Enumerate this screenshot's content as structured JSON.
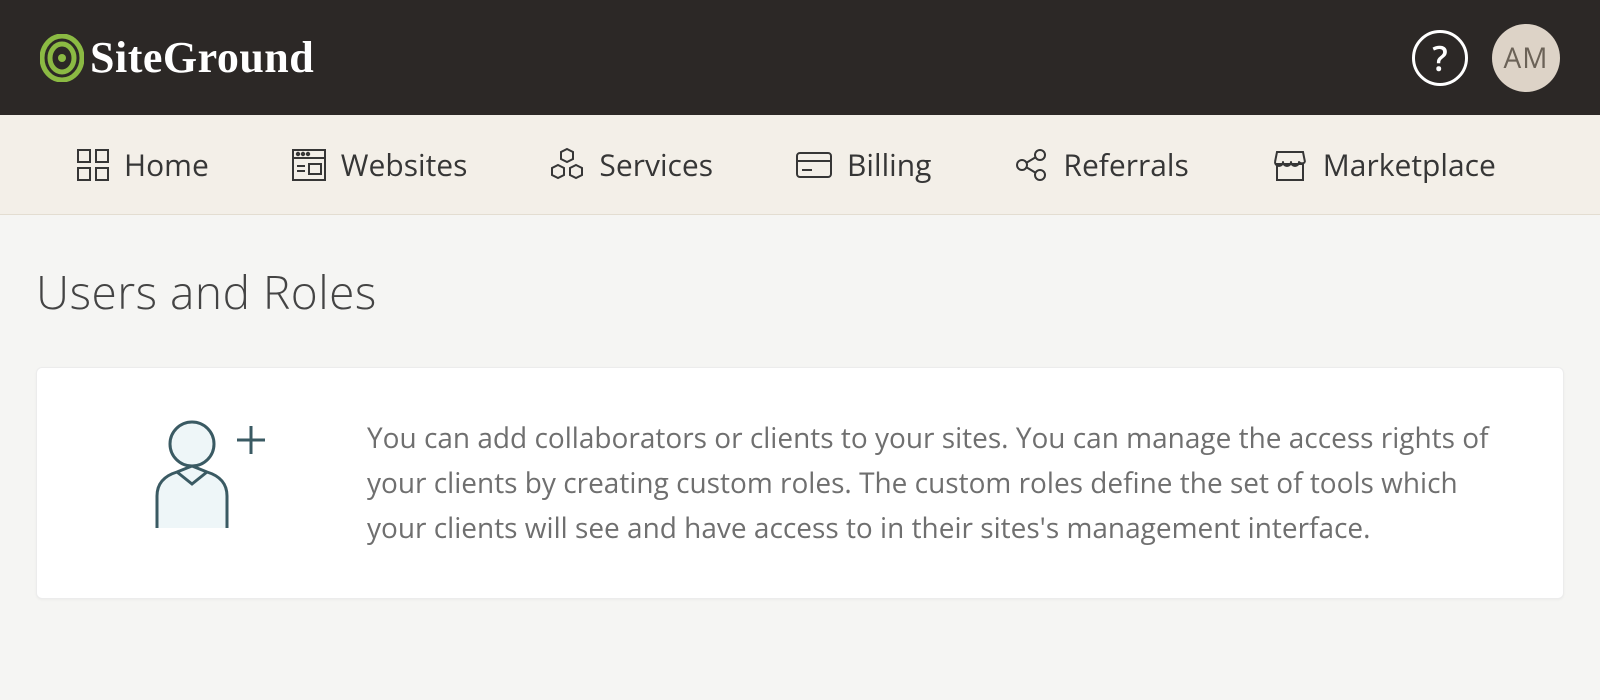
{
  "header": {
    "brand": "SiteGround",
    "help_label": "?",
    "avatar_initials": "AM"
  },
  "nav": {
    "items": [
      {
        "label": "Home",
        "icon": "home-grid-icon"
      },
      {
        "label": "Websites",
        "icon": "websites-icon"
      },
      {
        "label": "Services",
        "icon": "services-icon"
      },
      {
        "label": "Billing",
        "icon": "billing-icon"
      },
      {
        "label": "Referrals",
        "icon": "referrals-icon"
      },
      {
        "label": "Marketplace",
        "icon": "marketplace-icon"
      }
    ]
  },
  "main": {
    "title": "Users and Roles",
    "card": {
      "description": "You can add collaborators or clients to your sites. You can manage the access rights of your clients by creating custom roles. The custom roles define the set of tools which your clients will see and have access to in their sites's management interface."
    }
  },
  "colors": {
    "accent": "#8bba43",
    "topbar_bg": "#2c2826",
    "navbar_bg": "#f3efe8",
    "page_bg": "#f5f5f3",
    "text_muted": "#6f6f6f",
    "icon_stroke": "#3a5a63"
  }
}
